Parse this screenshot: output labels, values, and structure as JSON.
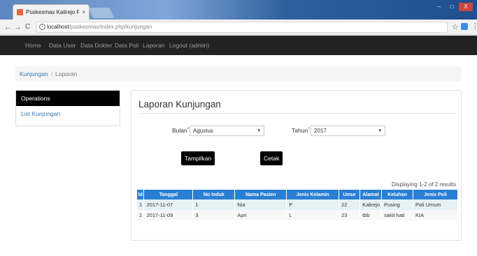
{
  "browser": {
    "tab_title": "Puskesmas Kalirejo Pes",
    "tab_close": "×",
    "url_host": "localhost",
    "url_path": "/puskesmas/index.php/kunjungan",
    "info_glyph": "i",
    "star_glyph": "☆",
    "menu_glyph": "⋮",
    "back_glyph": "←",
    "forward_glyph": "→",
    "reload_glyph": "C",
    "min_glyph": "–",
    "max_glyph": "□",
    "close_glyph": "X"
  },
  "navbar": {
    "items": [
      "Home",
      "Data User",
      "Data Dokter",
      "Data Poli",
      "Laporan",
      "Logout (admin)"
    ]
  },
  "breadcrumb": {
    "link": "Kunjungan",
    "separator": "/",
    "active": "Laporan"
  },
  "sidebar": {
    "header": "Operations",
    "items": [
      "List Kunjungan"
    ]
  },
  "main": {
    "title": "Laporan Kunjungan",
    "bulan_label": "Bulan",
    "bulan_value": "Agustus",
    "tahun_label": "Tahun",
    "tahun_value": "2017",
    "required_mark": "*",
    "caret": "▾",
    "show_button": "Tampilkan",
    "print_button": "Cetak",
    "summary": "Displaying 1-2 of 2 results"
  },
  "table": {
    "headers": [
      "Id",
      "Tanggal",
      "No Induk",
      "Nama Pasien",
      "Jenis Kelamin",
      "Umur",
      "Alamat",
      "Keluhan",
      "Jenis Poli"
    ],
    "rows": [
      [
        "1",
        "2017-11-07",
        "1",
        "Nia",
        "P",
        "22",
        "Kalirejo",
        "Pusing",
        "Poli Umum"
      ],
      [
        "2",
        "2017-11-09",
        "3",
        "Apri",
        "L",
        "23",
        "tbb",
        "sakit hati",
        "KIA"
      ]
    ]
  },
  "colors": {
    "navbar_bg": "#222222",
    "table_header": "#2a7fd4",
    "link": "#337ab7",
    "button_bg": "#000000"
  }
}
